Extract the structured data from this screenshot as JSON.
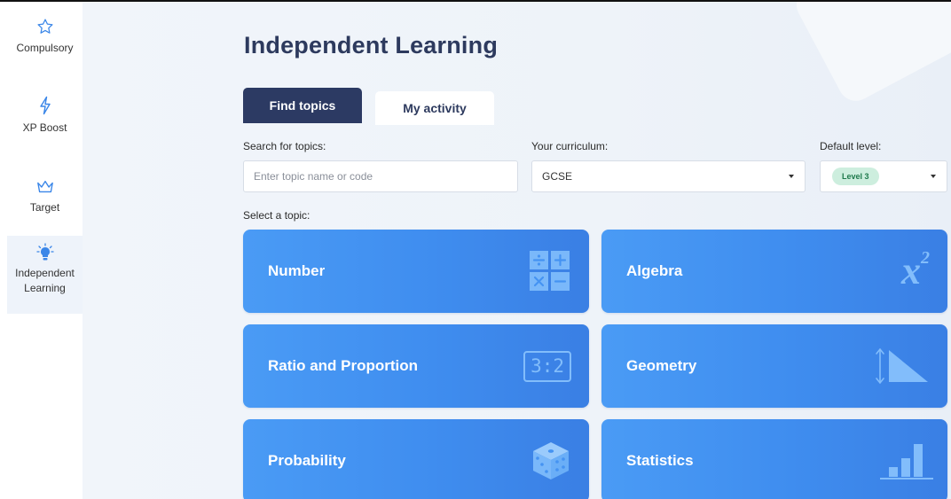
{
  "sidebar": {
    "items": [
      {
        "label": "Compulsory",
        "icon": "star-icon"
      },
      {
        "label": "XP Boost",
        "icon": "lightning-icon"
      },
      {
        "label": "Target",
        "icon": "crown-icon"
      },
      {
        "label_line1": "Independent",
        "label_line2": "Learning",
        "icon": "lightbulb-icon",
        "active": true
      }
    ]
  },
  "main": {
    "title": "Independent Learning",
    "tabs": [
      {
        "label": "Find topics",
        "active": true
      },
      {
        "label": "My activity",
        "active": false
      }
    ],
    "search": {
      "label": "Search for topics:",
      "placeholder": "Enter topic name or code",
      "value": ""
    },
    "curriculum": {
      "label": "Your curriculum:",
      "value": "GCSE"
    },
    "level": {
      "label": "Default level:",
      "value": "Level 3"
    },
    "select_topic_label": "Select a topic:",
    "topics": [
      {
        "label": "Number",
        "icon": "operators-icon"
      },
      {
        "label": "Algebra",
        "icon": "x-squared-icon",
        "icon_text": "x",
        "icon_sup": "2"
      },
      {
        "label": "Ratio and Proportion",
        "icon": "ratio-icon",
        "icon_text": "3:2"
      },
      {
        "label": "Geometry",
        "icon": "triangle-ruler-icon"
      },
      {
        "label": "Probability",
        "icon": "dice-icon"
      },
      {
        "label": "Statistics",
        "icon": "bar-chart-icon"
      }
    ]
  },
  "colors": {
    "tab_active": "#2c3a63",
    "card_blue": "#4593f2",
    "level_badge_bg": "#cdeede",
    "level_badge_text": "#1f7a4c",
    "sidebar_icon": "#3a86e8"
  }
}
